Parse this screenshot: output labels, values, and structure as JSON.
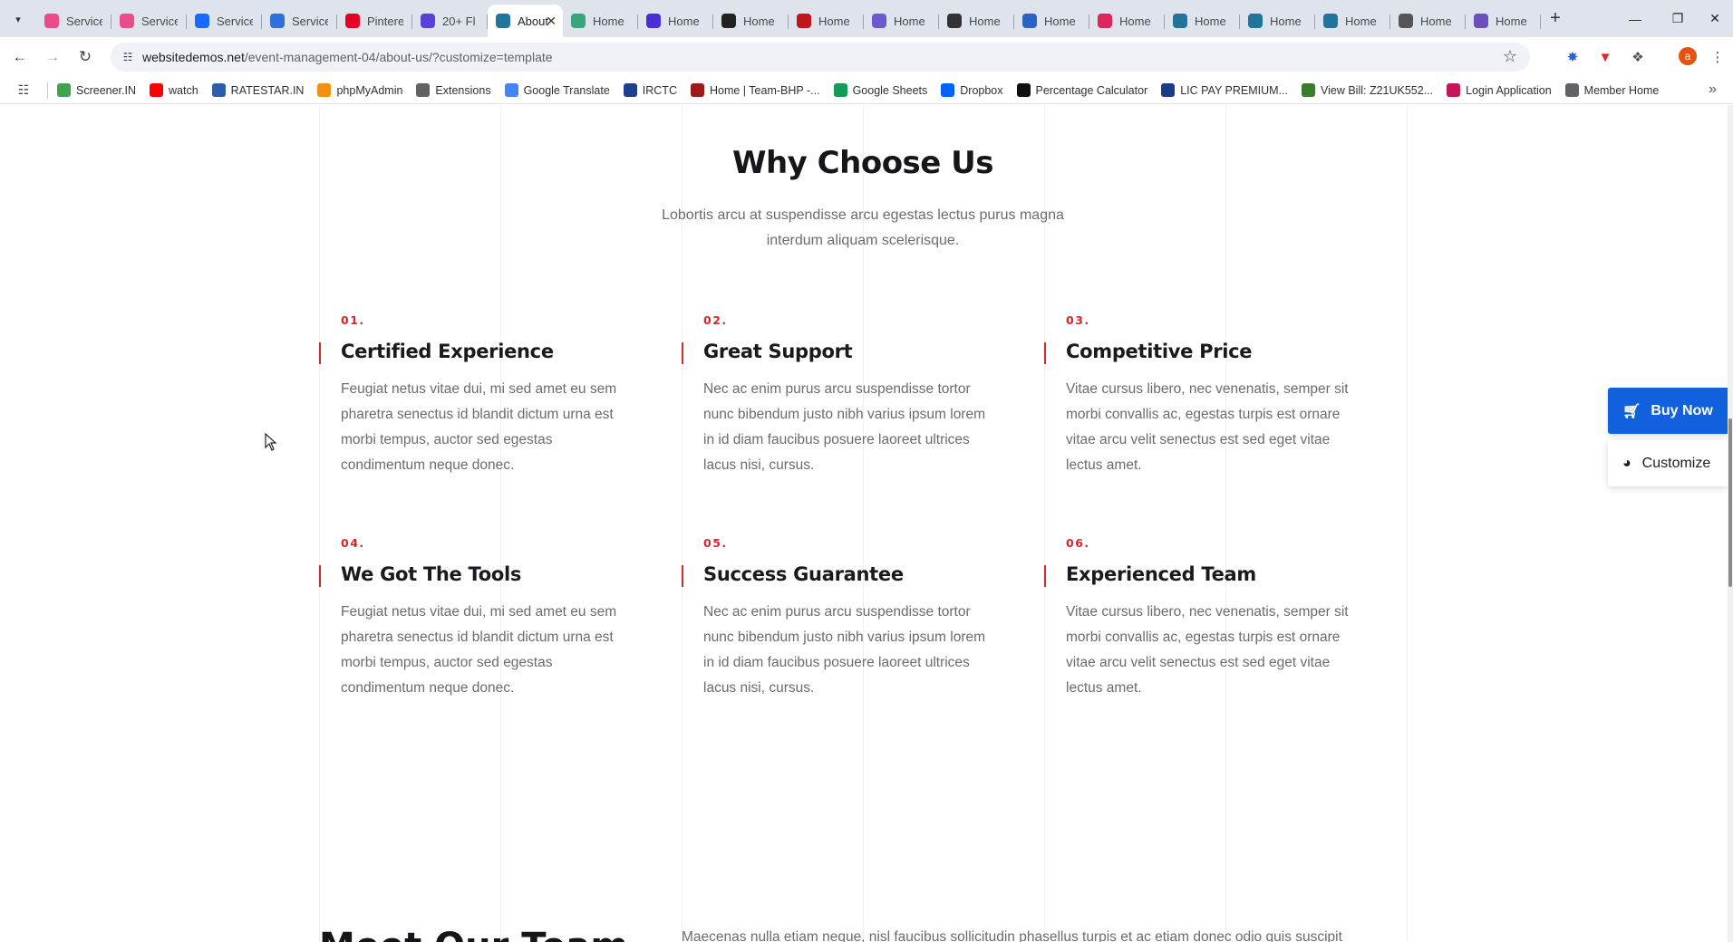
{
  "browser": {
    "tabs": [
      {
        "label": "Service",
        "favicon": "dribbble-icon",
        "color": "#ea4c89"
      },
      {
        "label": "Service",
        "favicon": "dribbble-icon",
        "color": "#ea4c89"
      },
      {
        "label": "Service",
        "favicon": "behance-icon",
        "color": "#1769ff"
      },
      {
        "label": "Service",
        "favicon": "notion-icon",
        "color": "#2f6fdc"
      },
      {
        "label": "Pinterest",
        "favicon": "pinterest-icon",
        "color": "#e60023"
      },
      {
        "label": "20+ Fl",
        "favicon": "astra-icon",
        "color": "#5b3fd9"
      },
      {
        "label": "About",
        "favicon": "wordpress-icon",
        "color": "#21759b",
        "active": true
      },
      {
        "label": "Home",
        "favicon": "gear-icon",
        "color": "#3aa57a"
      },
      {
        "label": "Home",
        "favicon": "info-icon",
        "color": "#4a2fd6"
      },
      {
        "label": "Home",
        "favicon": "w-icon",
        "color": "#222222"
      },
      {
        "label": "Home",
        "favicon": "flag-icon",
        "color": "#c3141c"
      },
      {
        "label": "Home",
        "favicon": "gear-icon",
        "color": "#6a5acd"
      },
      {
        "label": "Home",
        "favicon": "gb-icon",
        "color": "#333333"
      },
      {
        "label": "Home",
        "favicon": "globe-icon",
        "color": "#2a63c4"
      },
      {
        "label": "Home",
        "favicon": "circle-icon",
        "color": "#e0245e"
      },
      {
        "label": "Home",
        "favicon": "wordpress-icon",
        "color": "#21759b"
      },
      {
        "label": "Home",
        "favicon": "wordpress-icon",
        "color": "#21759b"
      },
      {
        "label": "Home",
        "favicon": "wordpress-icon",
        "color": "#21759b"
      },
      {
        "label": "Home",
        "favicon": "layout-icon",
        "color": "#555555"
      },
      {
        "label": "Home",
        "favicon": "cloud-icon",
        "color": "#6b4fbb"
      }
    ],
    "url_host": "websitedemos.net",
    "url_path": "/event-management-04/about-us/?customize=template",
    "profile_initial": "a",
    "bookmarks": [
      {
        "label": "Screener.IN",
        "icon": "chart-icon",
        "color": "#3fa34d"
      },
      {
        "label": "watch",
        "icon": "youtube-icon",
        "color": "#ff0000"
      },
      {
        "label": "RATESTAR.IN",
        "icon": "star-icon",
        "color": "#2b5dab"
      },
      {
        "label": "phpMyAdmin",
        "icon": "sail-icon",
        "color": "#f29111"
      },
      {
        "label": "Extensions",
        "icon": "puzzle-icon",
        "color": "#5f6368"
      },
      {
        "label": "Google Translate",
        "icon": "translate-icon",
        "color": "#4285f4"
      },
      {
        "label": "IRCTC",
        "icon": "train-icon",
        "color": "#1f3f8f"
      },
      {
        "label": "Home | Team-BHP -...",
        "icon": "team-bhp-icon",
        "color": "#9b1b1b"
      },
      {
        "label": "Google Sheets",
        "icon": "sheets-icon",
        "color": "#0f9d58"
      },
      {
        "label": "Dropbox",
        "icon": "dropbox-icon",
        "color": "#0061ff"
      },
      {
        "label": "Percentage Calculator",
        "icon": "percent-icon",
        "color": "#111111"
      },
      {
        "label": "LIC PAY PREMIUM...",
        "icon": "lic-icon",
        "color": "#1b3a8a"
      },
      {
        "label": "View Bill: Z21UK552...",
        "icon": "bill-icon",
        "color": "#3c7a2e"
      },
      {
        "label": "Login Application",
        "icon": "login-icon",
        "color": "#c2185b"
      },
      {
        "label": "Member Home",
        "icon": "globe-icon",
        "color": "#5f6368"
      }
    ]
  },
  "page": {
    "section_title": "Why Choose Us",
    "section_subtitle": "Lobortis arcu at suspendisse arcu egestas lectus purus magna interdum aliquam scelerisque.",
    "features": [
      {
        "num": "01.",
        "title": "Certified Experience",
        "desc": "Feugiat netus vitae dui, mi sed amet eu sem pharetra senectus id blandit dictum urna est morbi tempus, auctor sed egestas condimentum neque donec."
      },
      {
        "num": "02.",
        "title": "Great Support",
        "desc": "Nec ac enim purus arcu suspendisse tortor nunc bibendum justo nibh varius ipsum lorem in id diam faucibus posuere laoreet ultrices lacus nisi, cursus."
      },
      {
        "num": "03.",
        "title": "Competitive Price",
        "desc": "Vitae cursus libero, nec venenatis, semper sit morbi convallis ac, egestas turpis est ornare vitae arcu velit senectus est sed eget vitae lectus amet."
      },
      {
        "num": "04.",
        "title": "We Got The Tools",
        "desc": "Feugiat netus vitae dui, mi sed amet eu sem pharetra senectus id blandit dictum urna est morbi tempus, auctor sed egestas condimentum neque donec."
      },
      {
        "num": "05.",
        "title": "Success Guarantee",
        "desc": "Nec ac enim purus arcu suspendisse tortor nunc bibendum justo nibh varius ipsum lorem in id diam faucibus posuere laoreet ultrices lacus nisi, cursus."
      },
      {
        "num": "06.",
        "title": "Experienced Team",
        "desc": "Vitae cursus libero, nec venenatis, semper sit morbi convallis ac, egestas turpis est ornare vitae arcu velit senectus est sed eget vitae lectus amet."
      }
    ],
    "team_title": "Meet Our Team",
    "team_text": "Maecenas nulla etiam neque, nisl faucibus sollicitudin phasellus turpis et ac etiam donec odio quis suscipit",
    "buy_now_label": "Buy Now",
    "customize_label": "Customize",
    "accent_color": "#d9262c",
    "buy_color": "#1160de"
  }
}
